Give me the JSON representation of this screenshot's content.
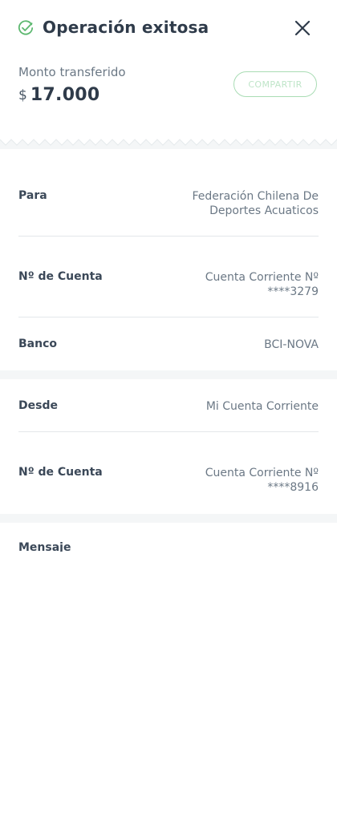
{
  "header": {
    "title": "Operación exitosa",
    "status_icon": "check-circle-icon",
    "close_icon": "close-icon"
  },
  "transfer": {
    "amount_label": "Monto transferido",
    "currency": "$",
    "amount": "17.000",
    "share_label": "COMPARTIR"
  },
  "recipient": {
    "rows": [
      {
        "label": "Para",
        "value_line1": "Federación Chilena De",
        "value_line2": "Deportes Acuaticos"
      },
      {
        "label": "Nº de Cuenta",
        "value_line1": "Cuenta Corriente Nº",
        "value_line2": "****3279"
      },
      {
        "label": "Banco",
        "value_line1": "BCI-NOVA",
        "value_line2": ""
      }
    ]
  },
  "origin": {
    "rows": [
      {
        "label": "Desde",
        "value_line1": "Mi Cuenta Corriente",
        "value_line2": ""
      },
      {
        "label": "Nº de Cuenta",
        "value_line1": "Cuenta Corriente Nº",
        "value_line2": "****8916"
      }
    ]
  },
  "message": {
    "label": "Mensaje"
  },
  "colors": {
    "success_green": "#5cb86f",
    "text_dark": "#2f3b4a",
    "text_muted": "#6b7885",
    "separator_band": "#f4f6f7"
  }
}
